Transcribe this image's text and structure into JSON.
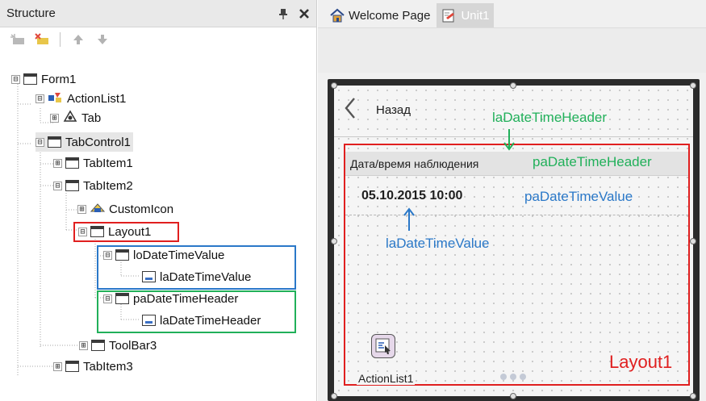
{
  "structure_panel": {
    "title": "Structure",
    "pin_icon": "pin-icon",
    "close_icon": "close-icon",
    "toolbar": [
      "add-item-icon",
      "delete-item-icon",
      "move-up-icon",
      "move-down-icon"
    ],
    "tree": [
      {
        "label": "Form1",
        "expander": "⊟",
        "icon": "form-icon"
      },
      {
        "label": "ActionList1",
        "expander": "⊟",
        "icon": "actionlist-icon"
      },
      {
        "label": "Tab",
        "expander": "⊞",
        "icon": "tab-action-icon"
      },
      {
        "label": "TabControl1",
        "expander": "⊟",
        "icon": "component-icon"
      },
      {
        "label": "TabItem1",
        "expander": "⊞",
        "icon": "component-icon"
      },
      {
        "label": "TabItem2",
        "expander": "⊟",
        "icon": "component-icon"
      },
      {
        "label": "CustomIcon",
        "expander": "⊞",
        "icon": "custom-icon"
      },
      {
        "label": "Layout1",
        "expander": "⊟",
        "icon": "component-icon"
      },
      {
        "label": "loDateTimeValue",
        "expander": "⊟",
        "icon": "component-icon"
      },
      {
        "label": "laDateTimeValue",
        "expander": "",
        "icon": "label-icon"
      },
      {
        "label": "paDateTimeHeader",
        "expander": "⊟",
        "icon": "component-icon"
      },
      {
        "label": "laDateTimeHeader",
        "expander": "",
        "icon": "label-icon"
      },
      {
        "label": "ToolBar3",
        "expander": "⊞",
        "icon": "component-icon"
      },
      {
        "label": "TabItem3",
        "expander": "⊞",
        "icon": "component-icon"
      }
    ]
  },
  "editor": {
    "tabs": [
      {
        "label": "Welcome Page",
        "icon": "home-icon"
      },
      {
        "label": "Unit1",
        "icon": "unit-icon"
      }
    ],
    "form": {
      "back_label": "Назад",
      "date_header_text": "Дата/время наблюдения",
      "date_value": "05.10.2015 10:00",
      "actionlist_label": "ActionList1"
    },
    "annotations": {
      "header_label": "laDateTimeHeader",
      "header_panel": "paDateTimeHeader",
      "value_panel": "paDateTimeValue",
      "value_label": "laDateTimeValue",
      "layout": "Layout1"
    }
  },
  "colors": {
    "highlight_red": "#e01f1f",
    "highlight_blue": "#2a78c8",
    "highlight_green": "#21b05a"
  }
}
